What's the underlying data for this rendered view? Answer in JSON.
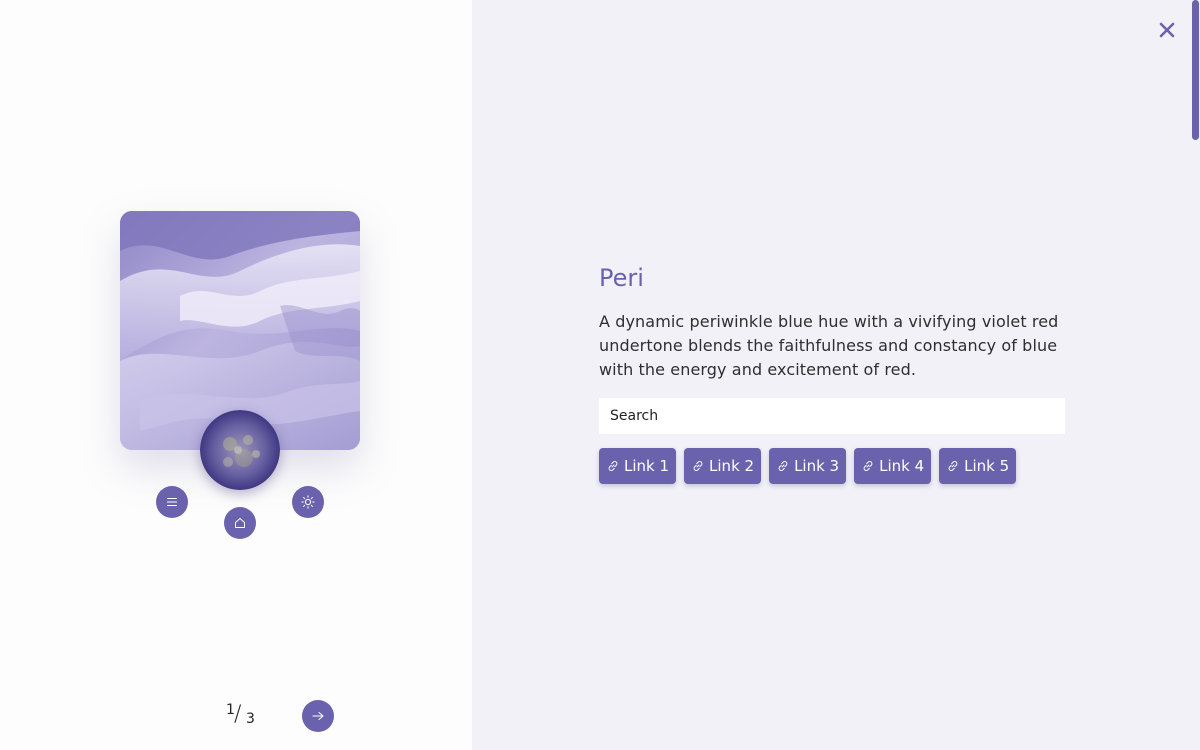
{
  "artwork": {
    "name": "Peri",
    "description": "A dynamic periwinkle blue hue with a vivifying violet red undertone blends the faithfulness and constancy of blue with the energy and excitement of red."
  },
  "search": {
    "placeholder": "Search"
  },
  "links": [
    {
      "label": "Link 1",
      "icon": "link-icon"
    },
    {
      "label": "Link 2",
      "icon": "link-icon"
    },
    {
      "label": "Link 3",
      "icon": "link-icon"
    },
    {
      "label": "Link 4",
      "icon": "link-icon"
    },
    {
      "label": "Link 5",
      "icon": "link-icon"
    }
  ],
  "pager": {
    "current": "1",
    "separator": "/",
    "total": "3"
  },
  "controls": {
    "menu_icon": "menu-icon",
    "home_icon": "home-icon",
    "brightness_icon": "sun-icon",
    "next_icon": "arrow-right-icon",
    "close_icon": "close-icon"
  },
  "colors": {
    "accent": "#6b62ad",
    "right_panel_bg": "#f1f1f7",
    "left_panel_bg": "#fdfdfd"
  }
}
